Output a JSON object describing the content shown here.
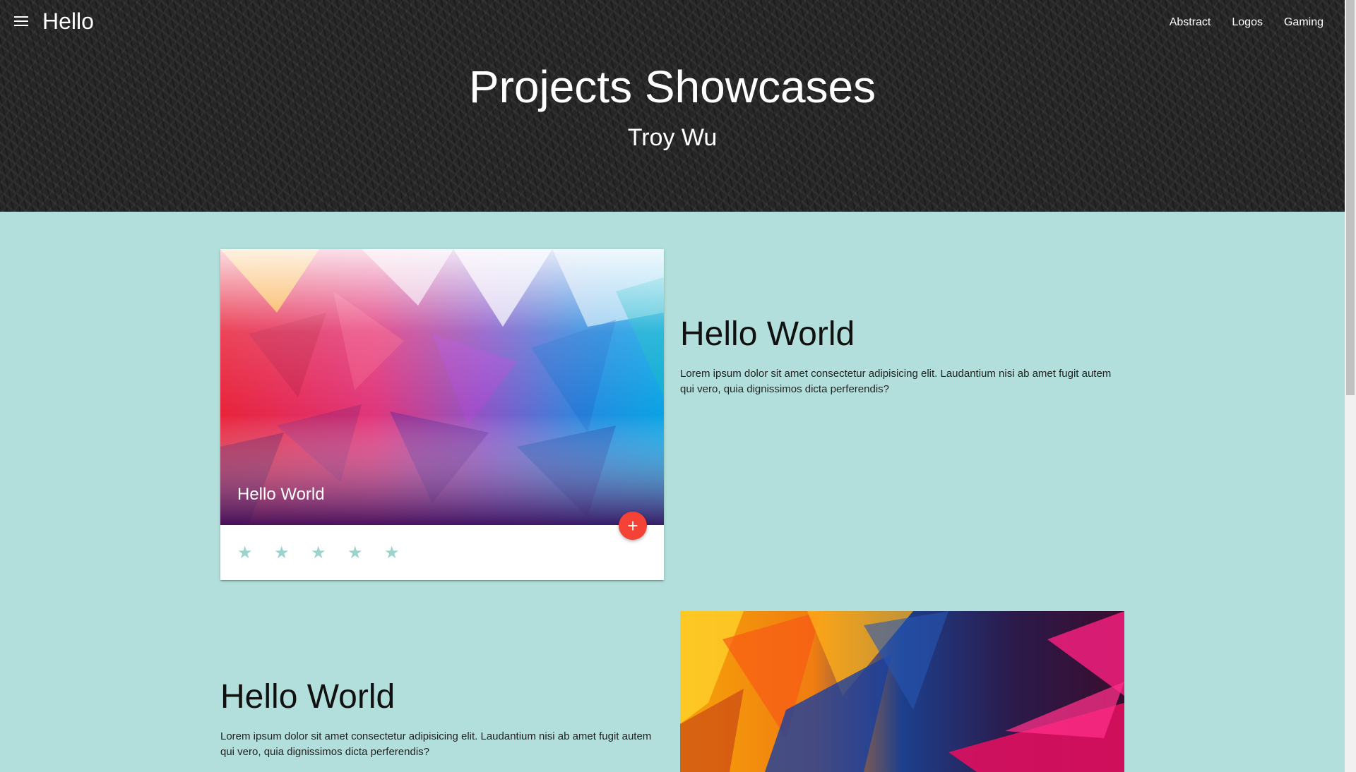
{
  "navbar": {
    "brand": "Hello",
    "links": [
      "Abstract",
      "Logos",
      "Gaming"
    ]
  },
  "hero": {
    "title": "Projects Showcases",
    "subtitle": "Troy Wu"
  },
  "featured_card": {
    "title": "Hello World",
    "fab_label": "+",
    "rating": "5 stars"
  },
  "sections": [
    {
      "heading": "Hello World",
      "body": "Lorem ipsum dolor sit amet consectetur adipisicing elit. Laudantium nisi ab amet fugit autem qui vero, quia dignissimos dicta perferendis?"
    },
    {
      "heading": "Hello World",
      "body": "Lorem ipsum dolor sit amet consectetur adipisicing elit. Laudantium nisi ab amet fugit autem qui vero, quia dignissimos dicta perferendis?"
    }
  ],
  "colors": {
    "page_bg": "#b2dfdb",
    "header_bg": "#262626",
    "fab": "#f44336",
    "star": "#9cd3cc"
  },
  "icons": {
    "menu": "menu-icon",
    "fab": "plus-icon",
    "rating": "star-icon"
  }
}
